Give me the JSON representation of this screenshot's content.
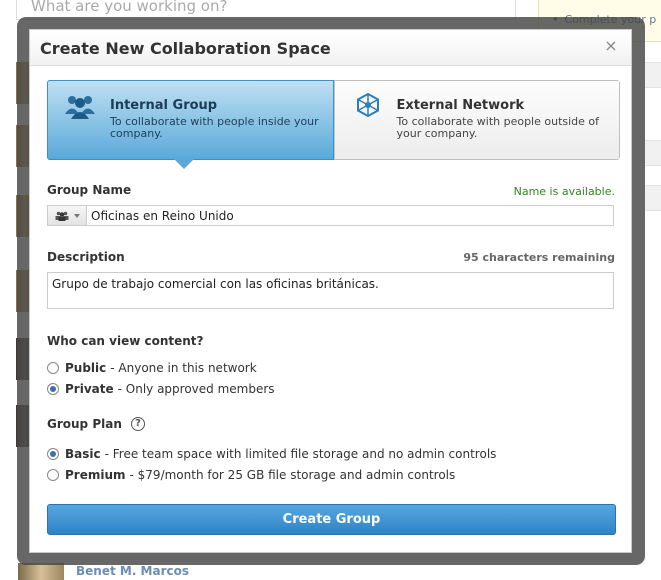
{
  "background": {
    "composer_placeholder": "What are you working on?",
    "tip_text": "Complete your p",
    "bottom_user_name": "Benet M. Marcos"
  },
  "modal": {
    "title": "Create New Collaboration Space",
    "close_symbol": "×",
    "group_types": [
      {
        "title": "Internal Group",
        "description": "To collaborate with people inside your company.",
        "icon": "people-icon",
        "selected": true
      },
      {
        "title": "External Network",
        "description": "To collaborate with people outside of your company.",
        "icon": "network-icon",
        "selected": false
      }
    ],
    "group_name": {
      "label": "Group Name",
      "status": "Name is available.",
      "value": "Oficinas en Reino Unido"
    },
    "description": {
      "label": "Description",
      "remaining": "95 characters remaining",
      "value": "Grupo de trabajo comercial con las oficinas británicas."
    },
    "visibility": {
      "label": "Who can view content?",
      "options": [
        {
          "name": "Public",
          "detail": "- Anyone in this network",
          "checked": false
        },
        {
          "name": "Private",
          "detail": "- Only approved members",
          "checked": true
        }
      ]
    },
    "plan": {
      "label": "Group Plan",
      "help_symbol": "?",
      "options": [
        {
          "name": "Basic",
          "detail": "- Free team space with limited file storage and no admin controls",
          "checked": true
        },
        {
          "name": "Premium",
          "detail": "- $79/month for 25 GB file storage and admin controls",
          "checked": false
        }
      ]
    },
    "submit_label": "Create Group"
  },
  "colors": {
    "accent_blue": "#2f82c4",
    "available_green": "#2e8b1a",
    "overlay": "#464646"
  }
}
